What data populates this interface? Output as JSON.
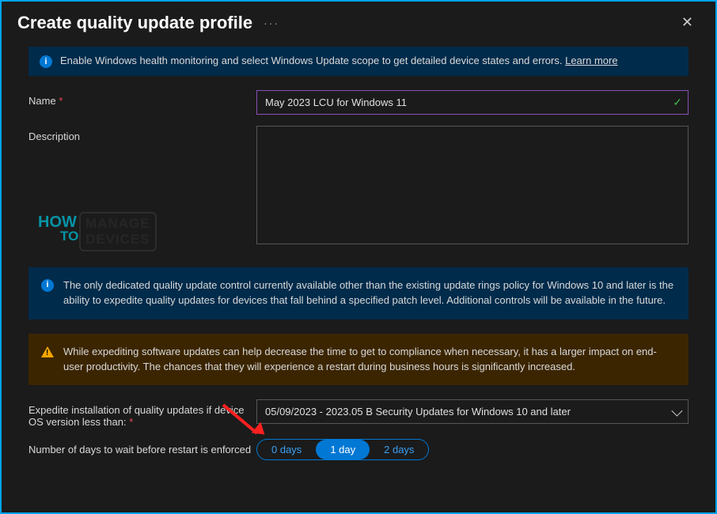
{
  "header": {
    "title": "Create quality update profile",
    "ellipsis": "···",
    "close_label": "✕"
  },
  "banner_top": {
    "text": "Enable Windows health monitoring and select Windows Update scope to get detailed device states and errors. ",
    "link": "Learn more"
  },
  "form": {
    "name_label": "Name",
    "name_value": "May 2023 LCU for Windows 11",
    "description_label": "Description",
    "description_value": "",
    "expedite_label": "Expedite installation of quality updates if device OS version less than:",
    "expedite_value": "05/09/2023 - 2023.05 B Security Updates for Windows 10 and later",
    "restart_label": "Number of days to wait before restart is enforced",
    "restart_options": [
      "0 days",
      "1 day",
      "2 days"
    ],
    "restart_selected": "1 day"
  },
  "info_block": {
    "text": "The only dedicated quality update control currently available other than the existing update rings policy for Windows 10 and later is the ability to expedite quality updates for devices that fall behind a specified patch level. Additional controls will be available in the future."
  },
  "warn_block": {
    "text": "While expediting software updates can help decrease the time to get to compliance when necessary, it has a larger impact on end-user productivity. The chances that they will experience a restart during business hours is significantly increased."
  },
  "watermark": {
    "how": "HOW",
    "to": "TO",
    "box": "MANAGE DEVICES"
  }
}
